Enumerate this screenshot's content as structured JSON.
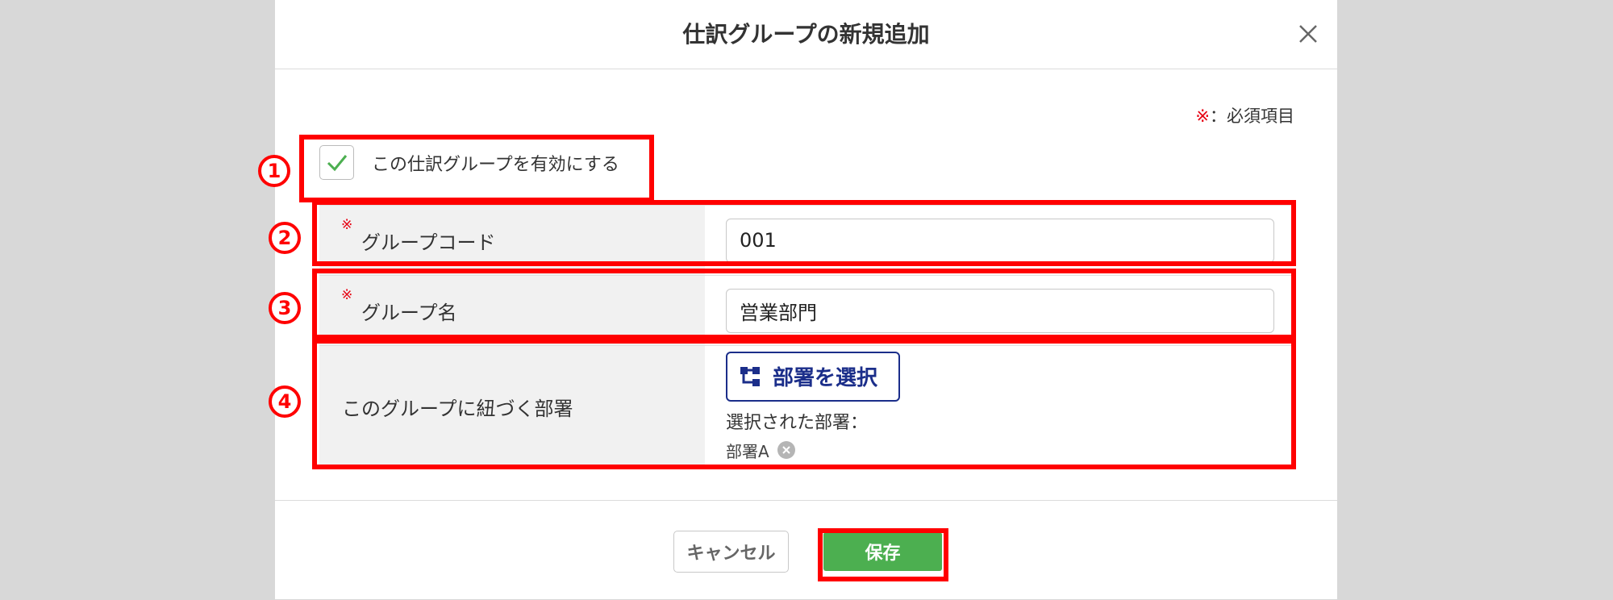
{
  "dialog": {
    "title": "仕訳グループの新規追加",
    "close_icon": "close-icon"
  },
  "required_note": {
    "mark": "※",
    "text": "：必須項目"
  },
  "enable": {
    "checked": true,
    "label": "この仕訳グループを有効にする"
  },
  "fields": {
    "required_mark": "※",
    "code_label": "グループコード",
    "code_value": "001",
    "name_label": "グループ名",
    "name_value": "営業部門",
    "dept_label": "このグループに紐づく部署",
    "dept_button": "部署を選択",
    "dept_button_icon": "org-tree-icon",
    "selected_label": "選択された部署：",
    "selected_dept": "部署A",
    "remove_icon": "remove-chip-icon"
  },
  "footer": {
    "cancel": "キャンセル",
    "save": "保存"
  },
  "annotations": {
    "n1": "1",
    "n2": "2",
    "n3": "3",
    "n4": "4"
  },
  "colors": {
    "required": "#e60012",
    "accent_blue": "#1b2e8a",
    "save_green": "#4caf50",
    "check_green": "#4caf50",
    "annotation_red": "#ff0000"
  }
}
